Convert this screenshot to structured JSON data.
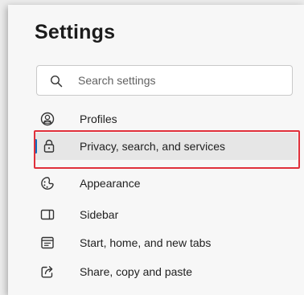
{
  "settings": {
    "title": "Settings",
    "search": {
      "placeholder": "Search settings",
      "icon": "search-icon"
    },
    "nav_items": [
      {
        "label": "Profiles",
        "icon": "profile-icon"
      },
      {
        "label": "Privacy, search, and services",
        "icon": "lock-icon",
        "selected": true
      },
      {
        "label": "Appearance",
        "icon": "appearance-icon"
      },
      {
        "label": "Sidebar",
        "icon": "sidebar-icon"
      },
      {
        "label": "Start, home, and new tabs",
        "icon": "start-home-icon"
      },
      {
        "label": "Share, copy and paste",
        "icon": "share-icon"
      }
    ]
  },
  "colors": {
    "accent": "#0f6cbd",
    "highlight_box": "#e0303a",
    "selected_bg": "#e6e6e6"
  }
}
